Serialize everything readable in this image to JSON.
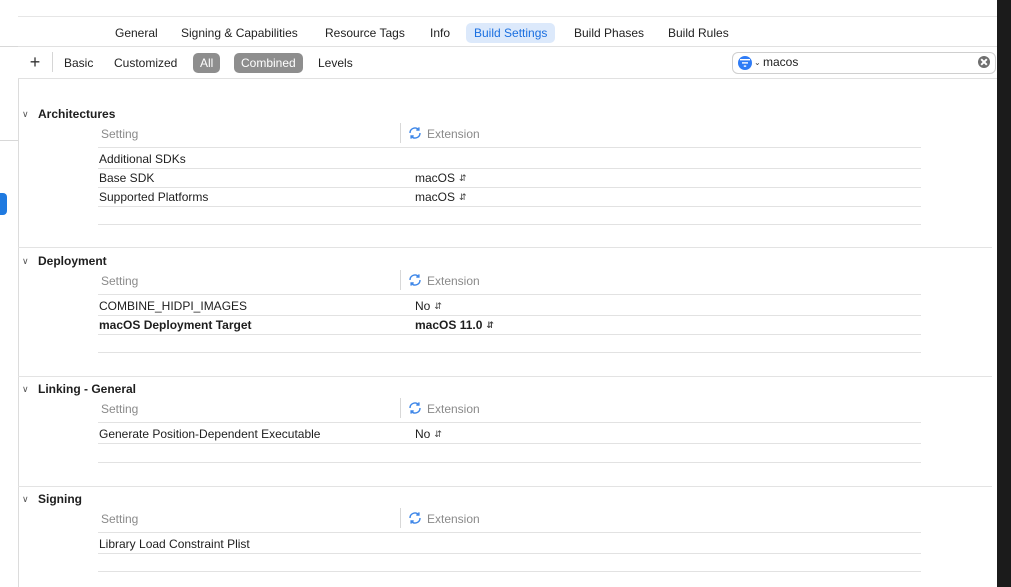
{
  "tabs": [
    {
      "label": "General",
      "active": false
    },
    {
      "label": "Signing & Capabilities",
      "active": false
    },
    {
      "label": "Resource Tags",
      "active": false
    },
    {
      "label": "Info",
      "active": false
    },
    {
      "label": "Build Settings",
      "active": true
    },
    {
      "label": "Build Phases",
      "active": false
    },
    {
      "label": "Build Rules",
      "active": false
    }
  ],
  "filter_bar": {
    "add_symbol": "+",
    "basic": "Basic",
    "customized": "Customized",
    "all": "All",
    "combined": "Combined",
    "levels": "Levels",
    "search_value": "macos"
  },
  "columns": {
    "setting": "Setting",
    "target": "Extension"
  },
  "sections": [
    {
      "title": "Architectures",
      "rows": [
        {
          "name": "Additional SDKs",
          "value": ""
        },
        {
          "name": "Base SDK",
          "value": "macOS"
        },
        {
          "name": "Supported Platforms",
          "value": "macOS"
        }
      ]
    },
    {
      "title": "Deployment",
      "rows": [
        {
          "name": "COMBINE_HIDPI_IMAGES",
          "value": "No"
        },
        {
          "name": "macOS Deployment Target",
          "value": "macOS 11.0",
          "bold": true
        }
      ]
    },
    {
      "title": "Linking - General",
      "rows": [
        {
          "name": "Generate Position-Dependent Executable",
          "value": "No"
        }
      ]
    },
    {
      "title": "Signing",
      "rows": [
        {
          "name": "Library Load Constraint Plist",
          "value": ""
        }
      ]
    }
  ],
  "colors": {
    "accent": "#1a6fe0",
    "active_tab_bg": "#dce9fb",
    "toggle_on_bg": "#8e8e8e",
    "secondary_text": "#8a8a8a"
  },
  "icons": {
    "add": "plus-icon",
    "filter": "filter-icon",
    "clear": "clear-search-icon",
    "target": "extension-target-icon",
    "disclosure": "chevron-down-icon",
    "popup": "up-down-chevron-icon"
  }
}
